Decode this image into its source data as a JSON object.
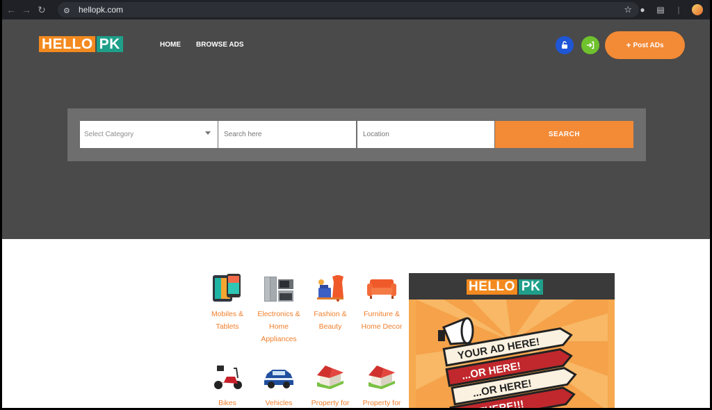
{
  "browser": {
    "url": "hellopk.com"
  },
  "brand": {
    "hello": "HELLO",
    "pk": "PK"
  },
  "nav": {
    "home": "HOME",
    "browse": "BROWSE ADS"
  },
  "header": {
    "post_label": "Post ADs"
  },
  "search": {
    "category_placeholder": "Select Category",
    "query_placeholder": "Search here",
    "location_placeholder": "Location",
    "button": "SEARCH"
  },
  "categories": [
    {
      "label_lines": [
        "Mobiles &",
        "Tablets"
      ],
      "icon": "mobile-tablet-icon"
    },
    {
      "label_lines": [
        "Electronics &",
        "Home",
        "Appliances"
      ],
      "icon": "appliances-icon"
    },
    {
      "label_lines": [
        "Fashion &",
        "Beauty"
      ],
      "icon": "fashion-icon"
    },
    {
      "label_lines": [
        "Furniture &",
        "Home Decor"
      ],
      "icon": "sofa-icon"
    },
    {
      "label_lines": [
        "Bikes"
      ],
      "icon": "scooter-icon"
    },
    {
      "label_lines": [
        "Vehicles"
      ],
      "icon": "car-icon"
    },
    {
      "label_lines": [
        "Property for"
      ],
      "icon": "house-icon"
    },
    {
      "label_lines": [
        "Property for"
      ],
      "icon": "house-icon"
    }
  ],
  "ad": {
    "brand_hello": "HELLO",
    "brand_pk": "PK",
    "lines": [
      "YOUR AD HERE!",
      "...OR HERE!",
      "...OR HERE!",
      "OR THERE!!!"
    ]
  },
  "colors": {
    "accent": "#f38a36",
    "brand_green": "#1f9f8a",
    "hero_bg": "#4a4a4a"
  }
}
